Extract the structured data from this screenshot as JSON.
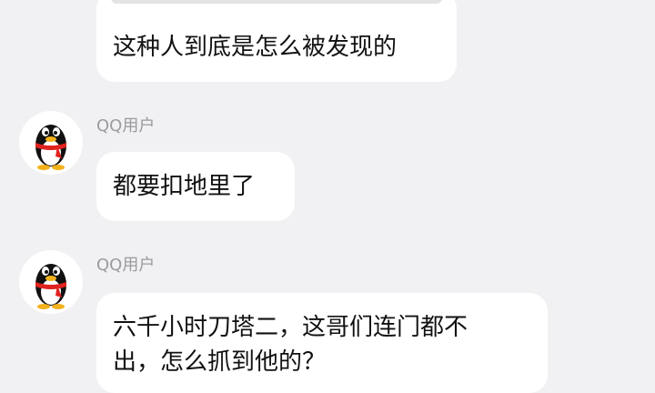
{
  "messages": [
    {
      "text": "这种人到底是怎么被发现的"
    },
    {
      "sender": "QQ用户",
      "avatar_icon": "qq-penguin-icon",
      "text": "都要扣地里了"
    },
    {
      "sender": "QQ用户",
      "avatar_icon": "qq-penguin-icon",
      "text_line1": "六千小时刀塔二，这哥们连门都不",
      "text_line2": "出，怎么抓到他的？"
    }
  ],
  "colors": {
    "background": "#f1f1f3",
    "bubble": "#ffffff",
    "sender_name": "#9a9a9f",
    "scarf_red": "#e0231f"
  }
}
